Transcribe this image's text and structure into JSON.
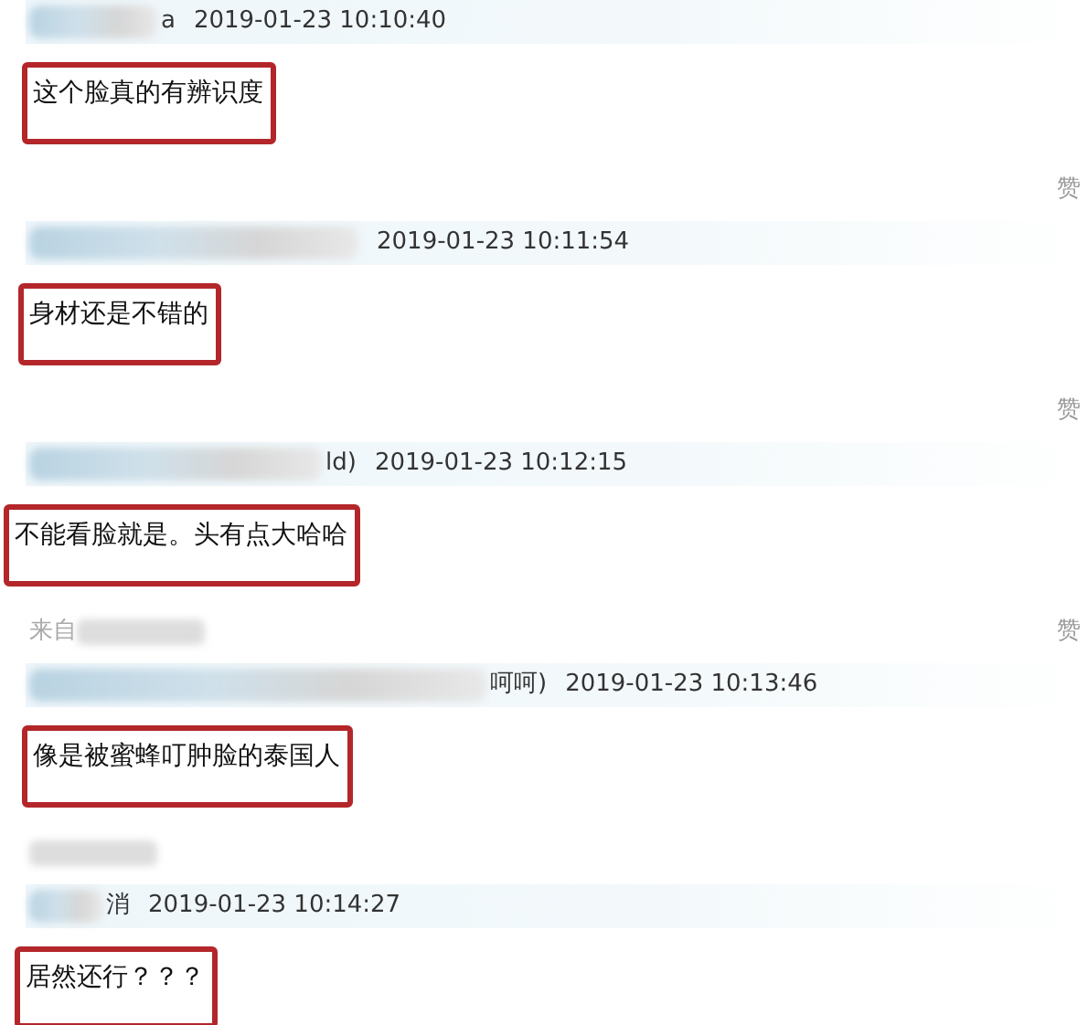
{
  "comments": [
    {
      "name_fragment": "a",
      "time": "2019-01-23 10:10:40",
      "text": "这个脸真的有辨识度",
      "footer": {
        "like": "赞"
      }
    },
    {
      "time": "2019-01-23 10:11:54",
      "text": "身材还是不错的",
      "footer": {
        "like": "赞"
      }
    },
    {
      "name_fragment": "ld)",
      "time": "2019-01-23 10:12:15",
      "text": "不能看脸就是。头有点大哈哈",
      "footer": {
        "source": "来自",
        "like": "赞"
      }
    },
    {
      "name_fragment": "呵呵)",
      "time": "2019-01-23 10:13:46",
      "text": "像是被蜜蜂叮肿脸的泰国人",
      "footer": {
        "blurred_source": true
      }
    },
    {
      "name_fragment": "消",
      "time": "2019-01-23 10:14:27",
      "text": "居然还行？？？"
    }
  ]
}
